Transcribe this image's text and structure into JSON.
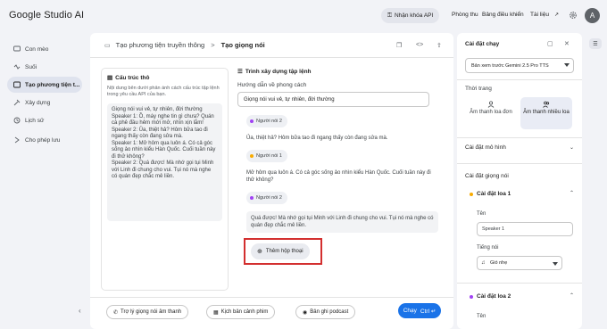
{
  "header": {
    "logo": "Google Studio AI",
    "api_key_label": "Nhận khóa API",
    "nav": [
      "Phòng thu",
      "Bảng điều khiển",
      "Tài liệu"
    ],
    "avatar_letter": "A"
  },
  "sidebar": {
    "items": [
      {
        "label": "Con mèo",
        "icon": "chat-icon"
      },
      {
        "label": "Suối",
        "icon": "stream-icon"
      },
      {
        "label": "Tạo phương tiện t...",
        "icon": "media-icon"
      },
      {
        "label": "Xây dựng",
        "icon": "build-icon"
      },
      {
        "label": "Lịch sử",
        "icon": "history-icon"
      },
      {
        "label": "Cho phép lưu",
        "icon": "save-toggle-icon"
      }
    ],
    "collapse_glyph": "‹"
  },
  "main": {
    "breadcrumb_1": "Tạo phương tiện truyền thông",
    "breadcrumb_sep": ">",
    "breadcrumb_2": "Tạo giọng nói",
    "code_glyph": "<>",
    "left_card": {
      "title": "Cấu trúc thô",
      "desc": "Nội dung bên dưới phản ánh cách cấu trúc tập lệnh trong yêu cầu API của bạn.",
      "script_lines": [
        "Giọng nói vui vẻ, tự nhiên, đời thường",
        "Speaker 1: Ồ, máy nghe tin gì chưa? Quán cà phê đầu hẻm mới mở, nhìn xịn lắm!",
        "Speaker 2: Ủa, thiệt hả? Hôm bữa tao đi ngang thấy còn đang sửa mà.",
        "Speaker 1: Mở hôm qua luôn á. Có cả góc sống ảo nhìn kiểu Hàn Quốc. Cuối tuần này đi thử không?",
        "Speaker 2: Quá được! Mà nhớ gọi tụi Minh với Linh đi chung cho vui. Tụi nó mà nghe có quán đẹp chắc mê liền."
      ]
    },
    "builder": {
      "title": "Trình xây dựng tập lệnh",
      "style_label": "Hướng dẫn về phong cách",
      "style_value": "Giọng nói vui vẻ, tự nhiên, đời thường",
      "speaker1": "Người nói 1",
      "speaker2": "Người nói 2",
      "lines": [
        {
          "speaker": "Người nói 2",
          "text": "Ủa, thiệt hả? Hôm bữa tao đi ngang thấy còn đang sửa mà."
        },
        {
          "speaker": "Người nói 1",
          "text": "Mở hôm qua luôn á. Có cả góc sống ảo nhìn kiểu Hàn Quốc. Cuối tuần này đi thử không?"
        },
        {
          "speaker": "Người nói 2",
          "text": "Quá được! Mà nhớ gọi tụi Minh với Linh đi chung cho vui. Tụi nó mà nghe có quán đẹp chắc mê liền."
        }
      ],
      "add_dialog": "Thêm hộp thoại"
    },
    "footer": {
      "btn1": "Trợ lý giọng nói âm thanh",
      "btn2": "Kịch bản cảnh phim",
      "btn3": "Bản ghi podcast",
      "run": "Chạy",
      "run_shortcut": "Ctrl ↵"
    }
  },
  "settings": {
    "title": "Cài đặt chạy",
    "model": "Bản xem trước Gemini 2.5 Pro TTS",
    "mode_label": "Thời trang",
    "mode_single": "Âm thanh loa đơn",
    "mode_multi": "Âm thanh nhiều loa",
    "model_settings": "Cài đặt mô hình",
    "voice_settings": "Cài đặt giọng nói",
    "speaker1_title": "Cài đặt loa 1",
    "name_label": "Tên",
    "speaker1_name": "Speaker 1",
    "voice_label": "Tiếng nói",
    "voice_value": "Gió nhẹ",
    "speaker2_title": "Cài đặt loa 2",
    "name_label_2": "Tên"
  },
  "colors": {
    "accent": "#1a73e8",
    "speaker1_dot": "#f9ab00",
    "speaker2_dot": "#a142f4",
    "highlight": "#d32f2f"
  }
}
